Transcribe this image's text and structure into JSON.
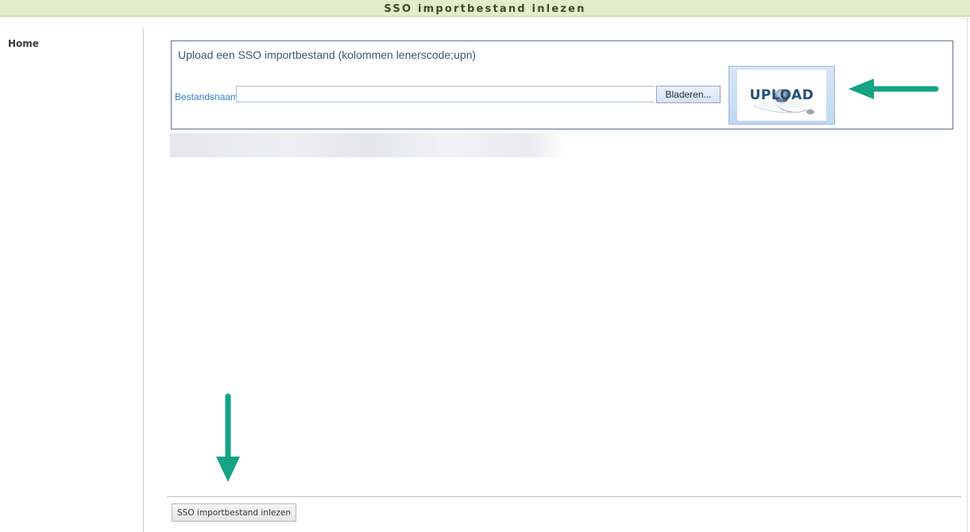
{
  "window": {
    "title": "SSO importbestand inlezen"
  },
  "sidebar": {
    "items": [
      {
        "label": "Home"
      }
    ]
  },
  "upload_panel": {
    "title": "Upload een SSO importbestand (kolommen lenerscode;upn)",
    "filename_label": "Bestandsnaam",
    "filename_value": "",
    "browse_label": "Bladeren...",
    "upload_image_text": "UPLOAD"
  },
  "footer": {
    "submit_label": "SSO importbestand inlezen"
  },
  "colors": {
    "titlebar_bg": "#e2ecc9",
    "accent_arrow": "#14a383",
    "label_blue": "#2f7fcf",
    "panel_border": "#5b708f"
  },
  "icons": {
    "upload_image": "upload-globe-mouse-icon",
    "annotation_arrows": [
      "arrow-left-icon",
      "arrow-down-icon"
    ]
  }
}
